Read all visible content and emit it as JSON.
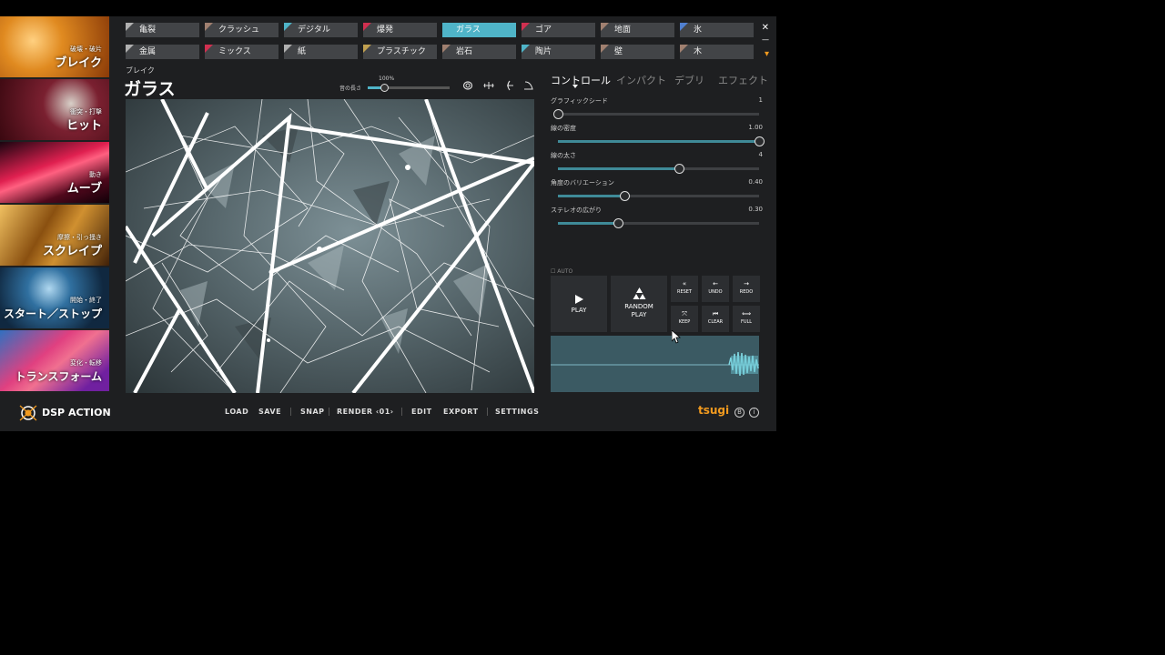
{
  "left_categories": [
    {
      "sub": "破壊・破片",
      "main": "ブレイク",
      "color": "#d98020"
    },
    {
      "sub": "衝突・打撃",
      "main": "ヒット",
      "color": "#8c1520"
    },
    {
      "sub": "動き",
      "main": "ムーブ",
      "color": "#c0203a"
    },
    {
      "sub": "摩擦・引っ掻き",
      "main": "スクレイプ",
      "color": "#a88030"
    },
    {
      "sub": "開始・終了",
      "main": "スタート／ストップ",
      "color": "#1f4a70"
    },
    {
      "sub": "変化・転移",
      "main": "トランスフォーム",
      "color": "#8c2060"
    }
  ],
  "materials": [
    {
      "label": "亀裂",
      "color": "#b0b0b0"
    },
    {
      "label": "クラッシュ",
      "color": "#a08070"
    },
    {
      "label": "デジタル",
      "color": "#4fb4c8"
    },
    {
      "label": "爆発",
      "color": "#d03050"
    },
    {
      "label": "ガラス",
      "color": "#4fb4c8"
    },
    {
      "label": "ゴア",
      "color": "#d03050"
    },
    {
      "label": "地面",
      "color": "#a08070"
    },
    {
      "label": "氷",
      "color": "#5080d0"
    },
    {
      "label": "金属",
      "color": "#b0b0b0"
    },
    {
      "label": "ミックス",
      "color": "#d03050"
    },
    {
      "label": "紙",
      "color": "#b0b0b0"
    },
    {
      "label": "プラスチック",
      "color": "#c0a050"
    },
    {
      "label": "岩石",
      "color": "#a08070"
    },
    {
      "label": "陶片",
      "color": "#4fb4c8"
    },
    {
      "label": "壁",
      "color": "#a08070"
    },
    {
      "label": "木",
      "color": "#a08070"
    }
  ],
  "active_material": "ガラス",
  "window_controls": {
    "close": "✕",
    "minimize": "—",
    "pin": "▾"
  },
  "header": {
    "category": "ブレイク",
    "title": "ガラス",
    "duration_label": "音の長さ",
    "duration_value": "100%",
    "duration_fraction": 0.2
  },
  "tabs": [
    "コントロール",
    "インパクト",
    "デブリ",
    "エフェクト"
  ],
  "params": [
    {
      "label": "グラフィックシード",
      "value": "1",
      "fraction": 0.0
    },
    {
      "label": "線の密度",
      "value": "1.00",
      "fraction": 1.0
    },
    {
      "label": "線の太さ",
      "value": "4",
      "fraction": 0.6
    },
    {
      "label": "角度のバリエーション",
      "value": "0.40",
      "fraction": 0.33
    },
    {
      "label": "ステレオの広がり",
      "value": "0.30",
      "fraction": 0.3
    }
  ],
  "auto_label": "AUTO",
  "play": {
    "label": "PLAY",
    "icon": "play-icon"
  },
  "random_play": {
    "label1": "RANDOM",
    "label2": "PLAY",
    "icon": "tsugi-triangle-icon"
  },
  "small_buttons": [
    {
      "label": "RESET",
      "icon": "«"
    },
    {
      "label": "UNDO",
      "icon": "←"
    },
    {
      "label": "REDO",
      "icon": "→"
    },
    {
      "label": "KEEP",
      "icon": "⤧"
    },
    {
      "label": "CLEAR",
      "icon": "⏮"
    },
    {
      "label": "FULL",
      "icon": "⟺"
    }
  ],
  "logo_text": "DSP ACTION",
  "menu": [
    "LOAD",
    "SAVE",
    "SNAP",
    "RENDER ‹01›",
    "EDIT",
    "EXPORT",
    "SETTINGS"
  ],
  "brand": "tsugi",
  "info_buttons": [
    "B",
    "i"
  ]
}
